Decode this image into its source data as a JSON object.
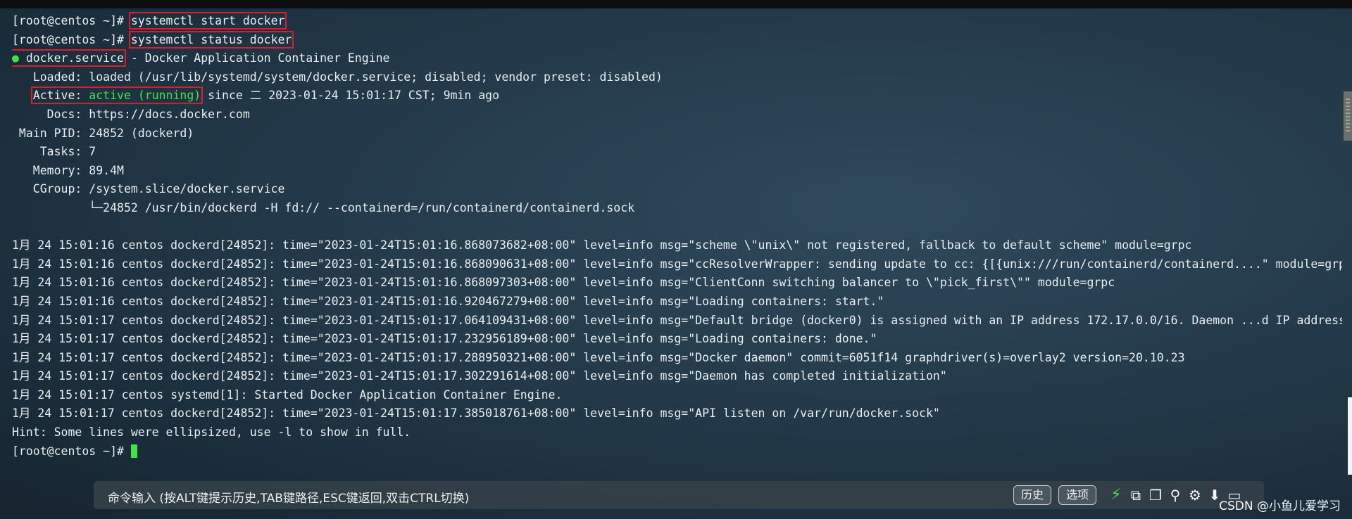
{
  "terminal": {
    "lines": [
      [
        "[root@centos ~]# ",
        {
          "t": "systemctl start docker",
          "box": true
        }
      ],
      [
        "[root@centos ~]# ",
        {
          "t": "systemctl status docker",
          "box": true
        }
      ],
      [
        {
          "t": "● docker.service",
          "box": true,
          "dot": true
        },
        " - Docker Application Container Engine"
      ],
      [
        "   Loaded: loaded (/usr/lib/systemd/system/docker.service; disabled; vendor preset: disabled)"
      ],
      [
        "   ",
        {
          "t": "Active: ",
          "box": true,
          "open": true
        },
        {
          "t": "active (running)",
          "green": true,
          "close": true
        },
        " since 二 2023-01-24 15:01:17 CST; 9min ago"
      ],
      [
        "     Docs: https://docs.docker.com"
      ],
      [
        " Main PID: 24852 (dockerd)"
      ],
      [
        "    Tasks: 7"
      ],
      [
        "   Memory: 89.4M"
      ],
      [
        "   CGroup: /system.slice/docker.service"
      ],
      [
        "           └─24852 /usr/bin/dockerd -H fd:// --containerd=/run/containerd/containerd.sock"
      ],
      [
        ""
      ],
      [
        "1月 24 15:01:16 centos dockerd[24852]: time=\"2023-01-24T15:01:16.868073682+08:00\" level=info msg=\"scheme \\\"unix\\\" not registered, fallback to default scheme\" module=grpc"
      ],
      [
        "1月 24 15:01:16 centos dockerd[24852]: time=\"2023-01-24T15:01:16.868090631+08:00\" level=info msg=\"ccResolverWrapper: sending update to cc: {[{unix:///run/containerd/containerd....\" module=grpc"
      ],
      [
        "1月 24 15:01:16 centos dockerd[24852]: time=\"2023-01-24T15:01:16.868097303+08:00\" level=info msg=\"ClientConn switching balancer to \\\"pick_first\\\"\" module=grpc"
      ],
      [
        "1月 24 15:01:16 centos dockerd[24852]: time=\"2023-01-24T15:01:16.920467279+08:00\" level=info msg=\"Loading containers: start.\""
      ],
      [
        "1月 24 15:01:17 centos dockerd[24852]: time=\"2023-01-24T15:01:17.064109431+08:00\" level=info msg=\"Default bridge (docker0) is assigned with an IP address 172.17.0.0/16. Daemon ...d IP address\""
      ],
      [
        "1月 24 15:01:17 centos dockerd[24852]: time=\"2023-01-24T15:01:17.232956189+08:00\" level=info msg=\"Loading containers: done.\""
      ],
      [
        "1月 24 15:01:17 centos dockerd[24852]: time=\"2023-01-24T15:01:17.288950321+08:00\" level=info msg=\"Docker daemon\" commit=6051f14 graphdriver(s)=overlay2 version=20.10.23"
      ],
      [
        "1月 24 15:01:17 centos dockerd[24852]: time=\"2023-01-24T15:01:17.302291614+08:00\" level=info msg=\"Daemon has completed initialization\""
      ],
      [
        "1月 24 15:01:17 centos systemd[1]: Started Docker Application Container Engine."
      ],
      [
        "1月 24 15:01:17 centos dockerd[24852]: time=\"2023-01-24T15:01:17.385018761+08:00\" level=info msg=\"API listen on /var/run/docker.sock\""
      ],
      [
        "Hint: Some lines were ellipsized, use -l to show in full."
      ],
      [
        "[root@centos ~]# ",
        {
          "cursor": true
        }
      ]
    ]
  },
  "command_bar": {
    "placeholder": "命令输入 (按ALT键提示历史,TAB键路径,ESC键返回,双击CTRL切换)",
    "history_label": "历史",
    "options_label": "选项"
  },
  "watermark": "CSDN @小鱼儿爱学习",
  "colors": {
    "highlight_box": "#d3202e",
    "running_green": "#3fe34a",
    "background": "#243a4a"
  }
}
